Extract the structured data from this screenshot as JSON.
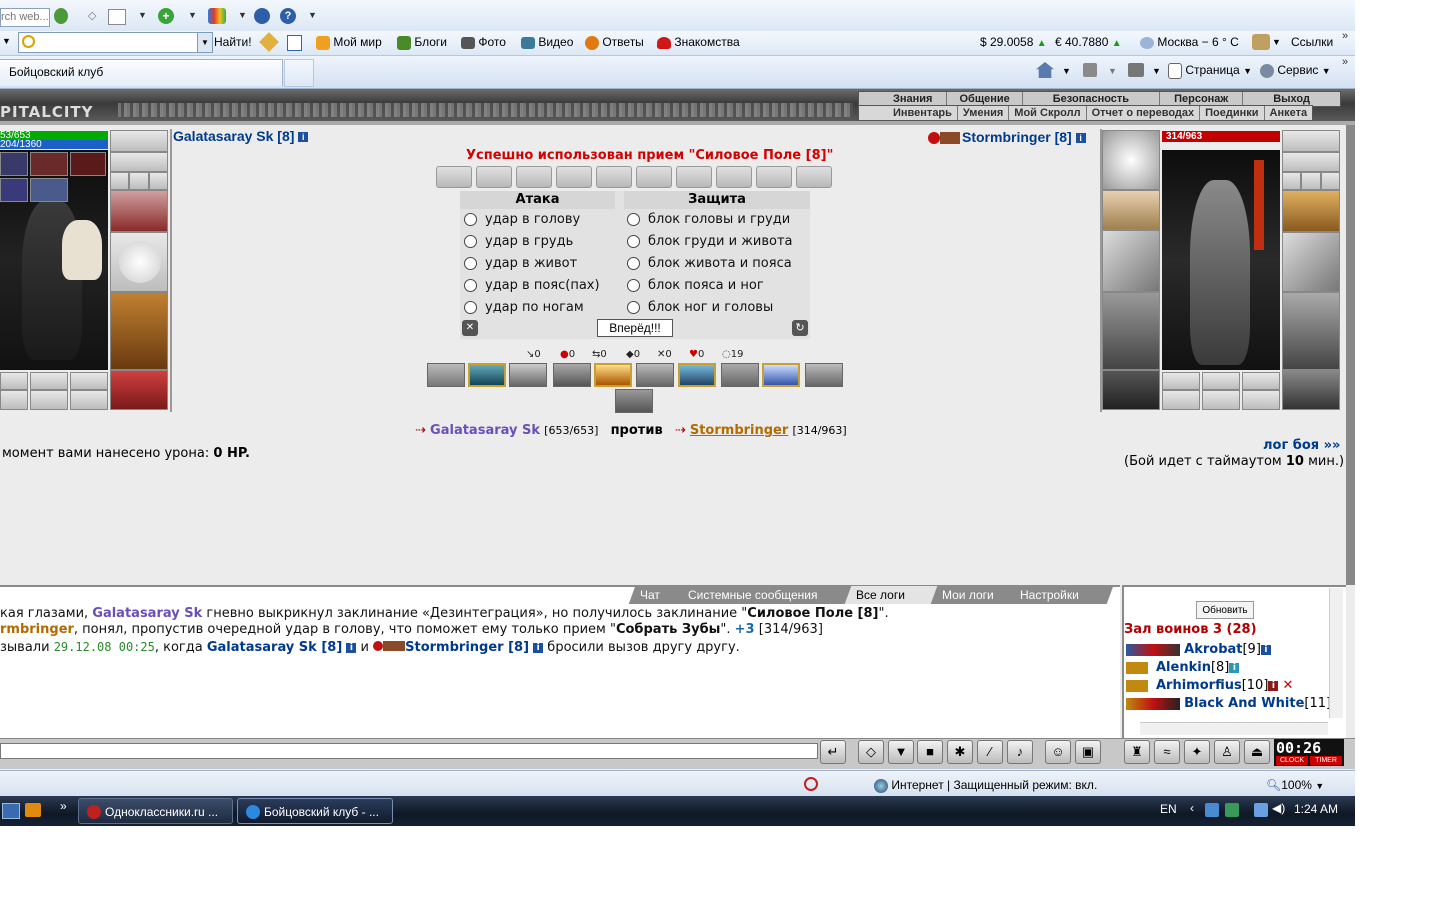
{
  "browser": {
    "search_placeholder": "rch web...",
    "links": [
      {
        "label": "Найти!"
      },
      {
        "label": "Мой мир"
      },
      {
        "label": "Блоги"
      },
      {
        "label": "Фото"
      },
      {
        "label": "Видео"
      },
      {
        "label": "Ответы"
      },
      {
        "label": "Знакомства"
      }
    ],
    "usd": "$ 29.0058",
    "eur": "€ 40.7880",
    "weather": "Москва  − 6 ° C",
    "links_menu": "Ссылки",
    "tab_title": "Бойцовский клуб",
    "page_menu": "Страница",
    "service_menu": "Сервис"
  },
  "game": {
    "city_title": "PITALCITY",
    "menu_top": [
      "Знания",
      "Общение",
      "Безопасность",
      "Персонаж",
      "Выход"
    ],
    "menu_bottom": [
      "Инвентарь",
      "Умения",
      "Мой Скролл",
      "Отчет о переводах",
      "Поединки",
      "Анкета"
    ],
    "player_left": {
      "name": "Galatasaray Sk [8]",
      "hp": "53/653",
      "mp": "204/1360"
    },
    "player_right": {
      "name": "Stormbringer [8]",
      "hp": "314/963"
    },
    "battle": {
      "message": "Успешно использован прием \"Силовое Поле [8]\"",
      "attack_header": "Атака",
      "defense_header": "Защита",
      "attacks": [
        "удар в голову",
        "удар в грудь",
        "удар в живот",
        "удар в пояс(пах)",
        "удар по ногам"
      ],
      "defenses": [
        "блок головы и груди",
        "блок груди и живота",
        "блок живота и пояса",
        "блок пояса и ног",
        "блок ног и головы"
      ],
      "go_button": "Вперёд!!!",
      "stats": [
        "0",
        "0",
        "0",
        "0",
        "0",
        "0",
        "19"
      ]
    },
    "versus": {
      "left_name": "Galatasaray Sk",
      "left_hp": "[653/653]",
      "word": "против",
      "right_name": "Stormbringer",
      "right_hp": "[314/963]"
    },
    "damage_prefix": "момент вами нанесено урона:",
    "damage_value": "0 HP.",
    "log_link": "лог боя »»",
    "timeout_prefix": "(Бой идет с таймаутом",
    "timeout_value": "10",
    "timeout_suffix": "мин.)"
  },
  "chat": {
    "tabs": [
      "Чат",
      "Системные сообщения",
      "Все логи",
      "Мои логи",
      "Настройки"
    ],
    "lines": [
      {
        "a": "кая глазами, ",
        "b": "Galatasaray Sk",
        "c": " гневно выкрикнул заклинание «Дезинтеграция», но получилось заклинание \"",
        "d": "Силовое Поле [8]",
        "e": "\"."
      },
      {
        "a": "rmbringer",
        "b": ", понял, пропустив очередной удар в голову, что поможет ему только прием \"",
        "c": "Собрать Зубы",
        "d": "\". ",
        "e": "+3",
        "f": " [314/963]"
      },
      {
        "a": "зывали ",
        "b": "29.12.08 00:25",
        "c": ", когда ",
        "d": "Galatasaray Sk [8]",
        "e": " и ",
        "f": "Stormbringer [8]",
        "g": " бросили вызов другу другу."
      }
    ],
    "refresh_button": "Обновить",
    "room_title": "Зал воинов 3 (28)",
    "players": [
      {
        "name": "Akrobat",
        "level": "[9]"
      },
      {
        "name": "Alenkin",
        "level": "[8]"
      },
      {
        "name": "Arhimorfius",
        "level": "[10]"
      },
      {
        "name": "Black And White",
        "level": "[11]"
      }
    ],
    "clock": "00:26",
    "clock_label": "CLOCK",
    "timer_label": "TIMER"
  },
  "statusbar": {
    "zone": "Интернет | Защищенный режим: вкл.",
    "zoom": "100%"
  },
  "taskbar": {
    "items": [
      {
        "label": "Одноклассники.ru ..."
      },
      {
        "label": "Бойцовский клуб - ..."
      }
    ],
    "lang": "EN",
    "time": "1:24 AM"
  },
  "colors": {
    "link_blue": "#003a8c",
    "log_purple": "#6a4fb8",
    "orange_name": "#b36a00",
    "message_red": "#d40000"
  }
}
